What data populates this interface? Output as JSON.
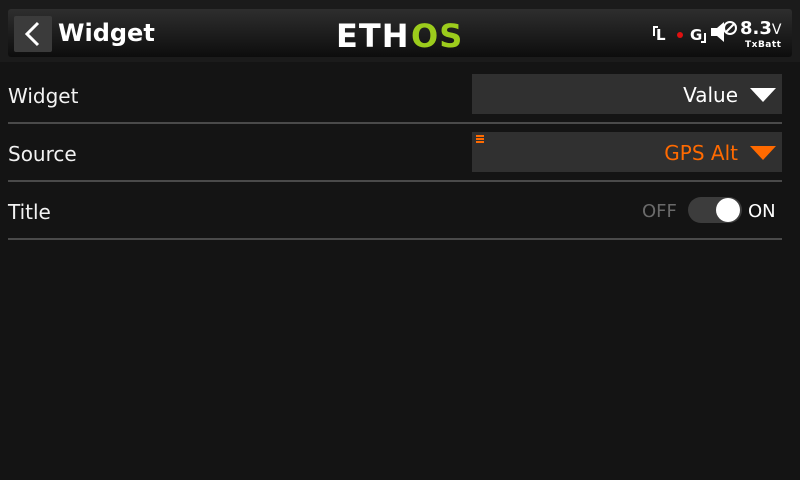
{
  "header": {
    "title": "Widget",
    "logo_text": "ETHOS",
    "log_indicator": "L",
    "gps_indicator": "G",
    "battery_value": "8.3",
    "battery_unit": "V",
    "battery_label": "TxBatt"
  },
  "form": {
    "widget": {
      "label": "Widget",
      "value": "Value"
    },
    "source": {
      "label": "Source",
      "value": "GPS Alt"
    },
    "title": {
      "label": "Title",
      "off_label": "OFF",
      "on_label": "ON",
      "state": "ON"
    }
  },
  "colors": {
    "accent": "#ff6a00",
    "logo_green": "#9ccc1c",
    "record_dot": "#e01010"
  },
  "icons": [
    "back-arrow-icon",
    "speaker-muted-icon",
    "dropdown-arrow-icon",
    "source-marker-icon"
  ]
}
